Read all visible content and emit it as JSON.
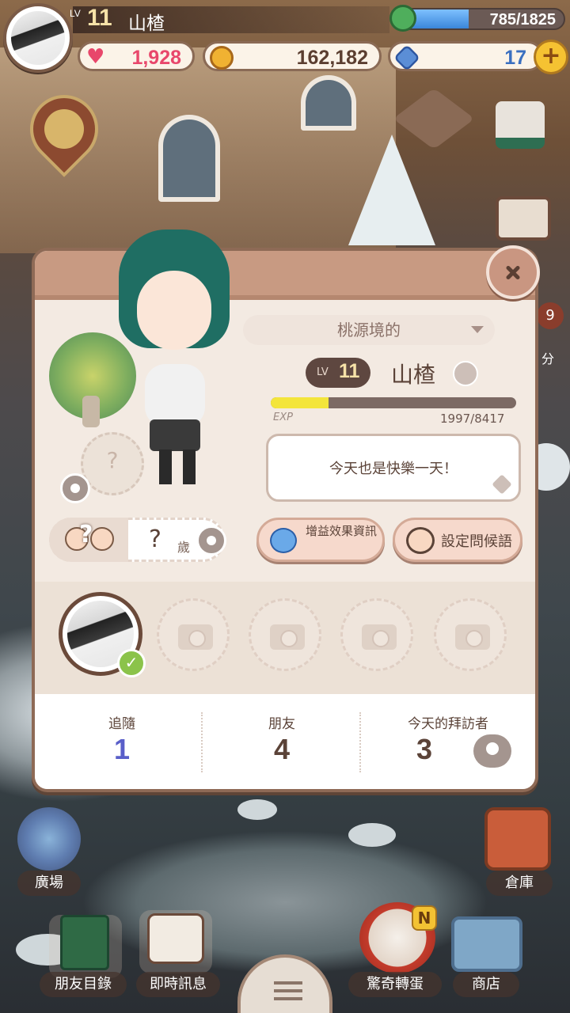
{
  "hud": {
    "level_prefix": "LV",
    "level": "11",
    "player_name": "山楂",
    "energy_text": "785/1825",
    "energy_fraction": 0.43,
    "hearts": "1,928",
    "coins": "162,182",
    "gems": "17",
    "add_gem_label": "+"
  },
  "profile": {
    "title_dropdown": "桃源境的",
    "level_prefix": "LV",
    "level": "11",
    "name": "山楂",
    "exp_label": "EXP",
    "exp_text": "1997/8417",
    "exp_fraction": 0.237,
    "greeting": "今天也是快樂一天！",
    "age_value": "?",
    "age_unit": "歲",
    "mystery_mark": "?",
    "buff_button": "增益效果資訊",
    "greeting_button": "設定問候語"
  },
  "stats": {
    "following_label": "追隨",
    "following_value": "1",
    "friends_label": "朋友",
    "friends_value": "4",
    "visitors_label": "今天的拜訪者",
    "visitors_value": "3"
  },
  "side": {
    "badge_count": "9",
    "label_partial": "分"
  },
  "nav": {
    "plaza": "廣場",
    "warehouse": "倉庫",
    "friends_list": "朋友目錄",
    "messages": "即時訊息",
    "gacha": "驚奇轉蛋",
    "shop": "商店",
    "gacha_badge": "N"
  },
  "colors": {
    "heart": "#e8476b",
    "exp_yellow": "#f3e53b",
    "following_blue": "#5a5fc9",
    "panel_border": "#8e6a56"
  }
}
